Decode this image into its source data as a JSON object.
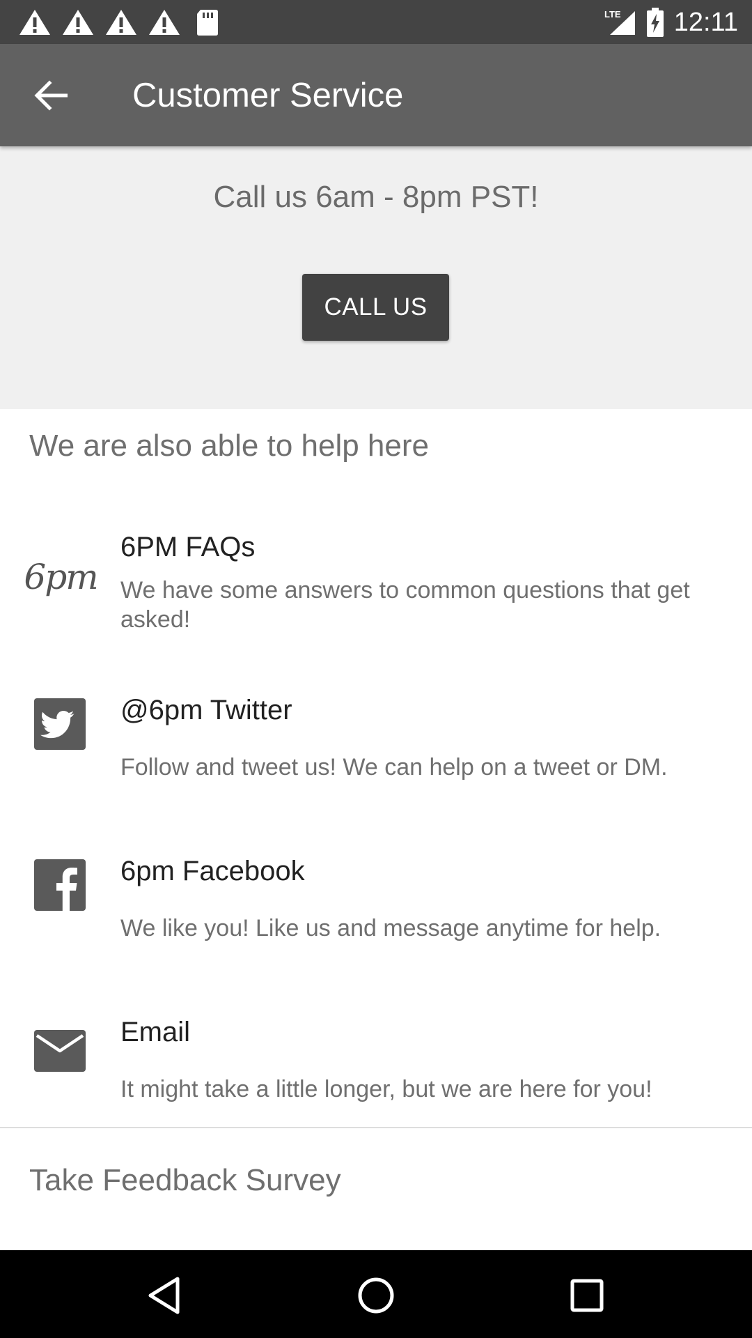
{
  "status_bar": {
    "time": "12:11",
    "network": "LTE",
    "icons": [
      "warning-icon",
      "warning-icon",
      "warning-icon",
      "warning-icon",
      "sd-card-icon",
      "signal-icon",
      "battery-charging-icon"
    ]
  },
  "app_bar": {
    "title": "Customer Service",
    "back_icon": "arrow-back-icon"
  },
  "call_panel": {
    "hours_text": "Call us 6am - 8pm PST!",
    "call_button_label": "CALL US"
  },
  "help_section": {
    "title": "We are also able to help here",
    "items": [
      {
        "icon": "6pm-logo",
        "logo_text": "6pm",
        "title": "6PM FAQs",
        "description": "We have some answers to common questions that get asked!"
      },
      {
        "icon": "twitter-icon",
        "title": "@6pm Twitter",
        "description": "Follow and tweet us! We can help on a tweet or DM."
      },
      {
        "icon": "facebook-icon",
        "title": "6pm Facebook",
        "description": "We like you! Like us and message anytime for help."
      },
      {
        "icon": "email-icon",
        "title": "Email",
        "description": "It might take a little longer, but we are here for you!"
      }
    ]
  },
  "survey": {
    "label": "Take Feedback Survey"
  },
  "nav_bar": {
    "buttons": [
      "back-triangle-icon",
      "home-circle-icon",
      "recents-square-icon"
    ]
  },
  "colors": {
    "status_bar": "#444444",
    "app_bar": "#616161",
    "call_panel": "#f0f0f0",
    "call_button": "#424242",
    "icon_gray": "#5a5a5a"
  }
}
